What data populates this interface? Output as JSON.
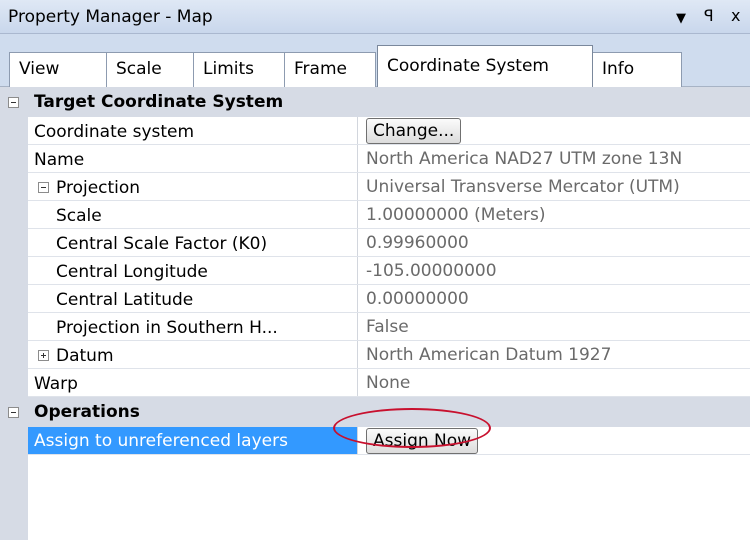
{
  "window": {
    "title": "Property Manager - Map",
    "controls": {
      "dropdown": "▼",
      "pin": "ꟼ",
      "close": "x"
    }
  },
  "tabs": [
    {
      "label": "View",
      "active": false
    },
    {
      "label": "Scale",
      "active": false
    },
    {
      "label": "Limits",
      "active": false
    },
    {
      "label": "Frame",
      "active": false
    },
    {
      "label": "Coordinate System",
      "active": true
    },
    {
      "label": "Info",
      "active": false
    }
  ],
  "sections": {
    "target": {
      "title": "Target Coordinate System",
      "rows": {
        "coordinate_system": {
          "name": "Coordinate system",
          "button": "Change..."
        },
        "name": {
          "name": "Name",
          "value": "North America NAD27 UTM zone 13N"
        },
        "projection": {
          "name": "Projection",
          "value": "Universal Transverse Mercator (UTM)"
        },
        "scale": {
          "name": "Scale",
          "value": "1.00000000 (Meters)"
        },
        "csf": {
          "name": "Central Scale Factor (K0)",
          "value": "0.99960000"
        },
        "clon": {
          "name": "Central Longitude",
          "value": "-105.00000000"
        },
        "clat": {
          "name": "Central Latitude",
          "value": "0.00000000"
        },
        "southern": {
          "name": "Projection in Southern H...",
          "value": "False"
        },
        "datum": {
          "name": "Datum",
          "value": "North American Datum 1927"
        },
        "warp": {
          "name": "Warp",
          "value": "None"
        }
      }
    },
    "operations": {
      "title": "Operations",
      "rows": {
        "assign": {
          "name": "Assign to unreferenced layers",
          "button": "Assign Now"
        }
      }
    }
  },
  "colors": {
    "selection": "#3399ff",
    "highlight_circle": "#c8102e",
    "category_bg": "#d6dbe5"
  }
}
